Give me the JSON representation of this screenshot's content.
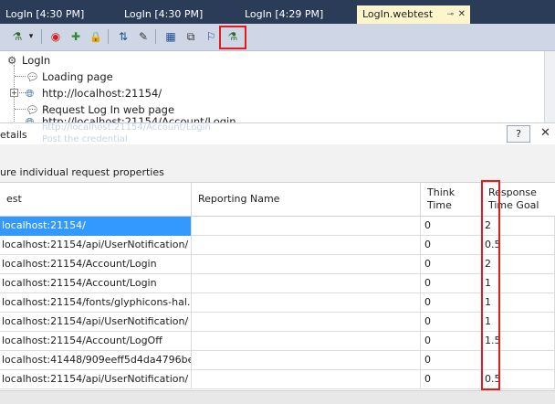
{
  "tabs": [
    {
      "label": "LogIn [4:30 PM]",
      "active": false
    },
    {
      "label": "LogIn [4:30 PM]",
      "active": false
    },
    {
      "label": "LogIn [4:29 PM]",
      "active": false
    },
    {
      "label": "LogIn.webtest",
      "active": true
    }
  ],
  "tab_icons": {
    "pin": "⊸",
    "close": "✕"
  },
  "toolbar": {
    "icons": [
      "add-request-icon",
      "dropdown-arrow-icon",
      "stop-icon",
      "add-plugin-icon",
      "lock-icon",
      "parameterize-icon",
      "extraction-icon",
      "datasource-icon",
      "generate-code-icon",
      "recorder-icon",
      "set-goal-icon"
    ],
    "glyphs": {
      "add_request": "⚗",
      "dropdown": "▾",
      "stop": "◉",
      "add_plugin": "✚",
      "lock": "🔒",
      "parameterize": "⇅",
      "extract": "✎",
      "datasource": "▦",
      "code": "⧉",
      "recorder": "⚐",
      "goal": "⚗"
    }
  },
  "tree": {
    "root": "LogIn",
    "items": [
      "Loading page",
      "http://localhost:21154/",
      "Request Log In web page",
      "http://localhost:21154/Account/Login"
    ],
    "ghost_items": [
      "http://localhost:21154/Account/Login",
      "Post the credential"
    ]
  },
  "details": {
    "title": "etails",
    "help_label": "?",
    "close_label": "✕",
    "subtitle": "ure individual request properties"
  },
  "grid": {
    "columns": [
      "est",
      "Reporting Name",
      "Think Time",
      "Response Time Goal"
    ],
    "rows": [
      {
        "request": "localhost:21154/",
        "reporting_name": "",
        "think_time": "0",
        "goal": "2",
        "selected": true
      },
      {
        "request": "localhost:21154/api/UserNotification/",
        "reporting_name": "",
        "think_time": "0",
        "goal": "0.5",
        "selected": false
      },
      {
        "request": "localhost:21154/Account/Login",
        "reporting_name": "",
        "think_time": "0",
        "goal": "2",
        "selected": false
      },
      {
        "request": "localhost:21154/Account/Login",
        "reporting_name": "",
        "think_time": "0",
        "goal": "1",
        "selected": false
      },
      {
        "request": "localhost:21154/fonts/glyphicons-hal...",
        "reporting_name": "",
        "think_time": "0",
        "goal": "1",
        "selected": false
      },
      {
        "request": "localhost:21154/api/UserNotification/",
        "reporting_name": "",
        "think_time": "0",
        "goal": "1",
        "selected": false
      },
      {
        "request": "localhost:21154/Account/LogOff",
        "reporting_name": "",
        "think_time": "0",
        "goal": "1.5",
        "selected": false
      },
      {
        "request": "localhost:41448/909eeff5d4da4796be...",
        "reporting_name": "",
        "think_time": "0",
        "goal": "",
        "selected": false
      },
      {
        "request": "localhost:21154/api/UserNotification/",
        "reporting_name": "",
        "think_time": "0",
        "goal": "0.5",
        "selected": false
      }
    ]
  },
  "colors": {
    "tab_bar": "#2b3c59",
    "active_tab": "#fff5cc",
    "toolbar": "#cfd6e5",
    "selection": "#3399ff",
    "highlight": "#e31b1b"
  }
}
